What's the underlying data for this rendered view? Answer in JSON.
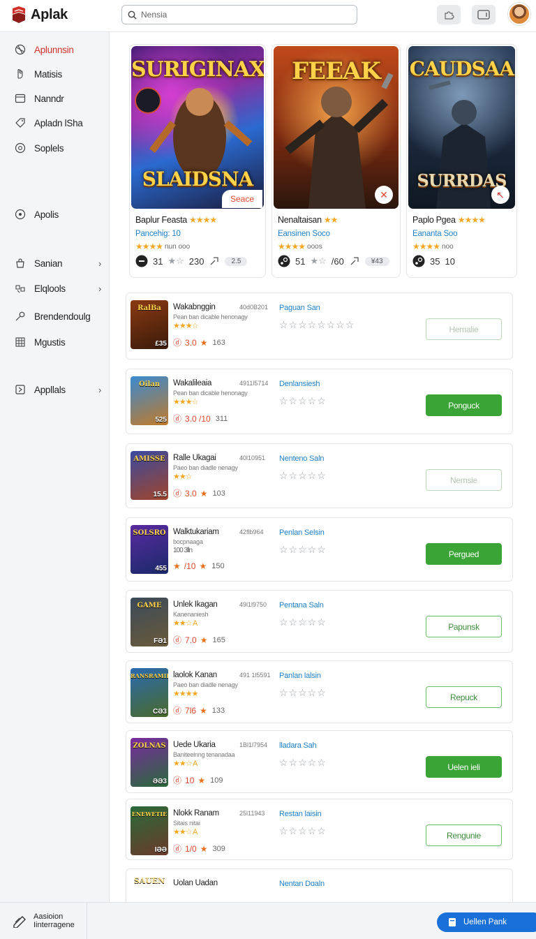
{
  "header": {
    "app_name": "Aplak",
    "search_placeholder": "Nensia"
  },
  "sidebar": {
    "items": [
      {
        "label": "Aplunnsin",
        "icon": "globe-icon"
      },
      {
        "label": "Matisis",
        "icon": "hand-icon"
      },
      {
        "label": "Nanndr",
        "icon": "card-icon"
      },
      {
        "label": "Apladn lSha",
        "icon": "tag-icon"
      },
      {
        "label": "Soplels",
        "icon": "chat-icon"
      },
      {
        "label": "Apolis",
        "icon": "circle-icon"
      },
      {
        "label": "Sanian",
        "icon": "bag-icon"
      },
      {
        "label": "Elqlools",
        "icon": "gamepad-icon"
      },
      {
        "label": "Brendendoulg",
        "icon": "key-icon"
      },
      {
        "label": "Mgustis",
        "icon": "grid-icon"
      },
      {
        "label": "Appllals",
        "icon": "app-icon"
      }
    ]
  },
  "featured": [
    {
      "art_title": "SURIGINAX",
      "art_sub": "SLAIDSNA",
      "name": "Baplur Feasta",
      "stars": "★★★★",
      "dev": "Pancehig: 10",
      "sub_stars": "★★★★",
      "sub": "nun ooo",
      "stat1": "31",
      "stat2": "230",
      "pill": "2.5",
      "badge": "Seace"
    },
    {
      "art_title": "FEEAK",
      "art_sub": "",
      "name": "Nenaltaisan",
      "stars": "★★",
      "dev": "Eansinen Soco",
      "sub_stars": "★★★★",
      "sub": "ooos",
      "stat1": "51",
      "stat2": "/60",
      "pill": "¥43",
      "badge": "✕"
    },
    {
      "art_title": "CAUDSAA",
      "art_sub": "SURRDAS",
      "name": "Paplo Pgea",
      "stars": "★★★★",
      "dev": "Eananta Soo",
      "sub_stars": "★★★★",
      "sub": "noo",
      "stat1": "35",
      "stat2": "10",
      "pill": "",
      "badge": "↖"
    }
  ],
  "rows": [
    {
      "thumb_text": "RalBa",
      "thumb_num": "£35",
      "title": "Wakabnggin",
      "code": "40d0B201",
      "desc": "Pean ban dicable henonagy",
      "stars": "★★★☆",
      "meta_icon": "ⓓ",
      "rating": "3.0",
      "count": "163",
      "publisher": "Paguan San",
      "empty_stars": "☆☆☆☆☆☆☆☆",
      "button": "Hemalie",
      "style": "ghost"
    },
    {
      "thumb_text": "Oilan",
      "thumb_num": "525",
      "title": "Wakalileaia",
      "code": "4911l5714",
      "desc": "Pean ban dicable henonagy",
      "stars": "★★★☆",
      "meta_icon": "ⓓ",
      "rating": "3.0 /10",
      "count": "311",
      "publisher": "Denlansiesh",
      "empty_stars": "☆☆☆☆☆",
      "button": "Ponguck",
      "style": "solid"
    },
    {
      "thumb_text": "AMISSE",
      "thumb_num": "15.5",
      "title": "Ralle Ukagai",
      "code": "40l10951",
      "desc": "Paeo ban diadle nenagy",
      "stars": "★★☆",
      "meta_icon": "ⓓ",
      "rating": "3.0",
      "count": "103",
      "publisher": "Nenteno Saln",
      "empty_stars": "☆☆☆☆☆",
      "button": "Nemsie",
      "style": "ghost"
    },
    {
      "thumb_text": "SOLSRO",
      "thumb_num": "455",
      "title": "Walktukariam",
      "code": "42flb964",
      "desc": "bocpnaaga",
      "desc2": "100 3lln",
      "stars": "",
      "meta_icon": "★",
      "rating": "/10",
      "count": "150",
      "publisher": "Penlan Selsin",
      "empty_stars": "☆☆☆☆☆",
      "button": "Pergued",
      "style": "solid"
    },
    {
      "thumb_text": "GAME",
      "thumb_num": "FƏ1",
      "title": "Unlek Ikagan",
      "code": "49l1l9750",
      "desc": "Kanenaniesh",
      "stars": "★★☆ A",
      "meta_icon": "ⓓ",
      "rating": "7.0",
      "count": "165",
      "publisher": "Pentana Saln",
      "empty_stars": "☆☆☆☆☆",
      "button": "Papunsk",
      "style": "outline"
    },
    {
      "thumb_text": "RANSRAMIE",
      "thumb_num": "CƏ3",
      "title": "laolok Kanan",
      "code": "491 1l5591",
      "desc": "Paeo ban diadle nenagy",
      "stars": "★★★★",
      "meta_icon": "ⓓ",
      "rating": "7l6",
      "count": "133",
      "publisher": "Panlan lalsin",
      "empty_stars": "☆☆☆☆☆",
      "button": "Repuck",
      "style": "outline"
    },
    {
      "thumb_text": "ZOLNAS",
      "thumb_num": "ƏƏ3",
      "title": "Uede Ukaria",
      "code": "1Bl1l7954",
      "desc": "Baniteelnng tenanadaa",
      "stars": "★★☆ A",
      "meta_icon": "ⓓ",
      "rating": "10",
      "count": "109",
      "publisher": "lladara Sah",
      "empty_stars": "☆☆☆☆☆",
      "button": "Uelen ieli",
      "style": "solid"
    },
    {
      "thumb_text": "ENEWETIE",
      "thumb_num": "IƏƏ",
      "title": "Nlokk Ranam",
      "code": "25l11943",
      "desc": "Sitais nitai",
      "stars": "★★☆ A",
      "meta_icon": "ⓓ",
      "rating": "1/0",
      "count": "309",
      "publisher": "Restan laisin",
      "empty_stars": "☆☆☆☆☆",
      "button": "Rengunie",
      "style": "outline"
    },
    {
      "thumb_text": "SAUEN",
      "thumb_num": "",
      "title": "Uolan Uadan",
      "code": "",
      "desc": "",
      "stars": "",
      "meta_icon": "",
      "rating": "",
      "count": "",
      "publisher": "Nentan Dɑaln",
      "empty_stars": "",
      "button": "",
      "style": "none"
    }
  ],
  "footer": {
    "left_line1": "Aasioion",
    "left_line2": "Iinterragene",
    "cta_label": "Uellen Pank"
  }
}
